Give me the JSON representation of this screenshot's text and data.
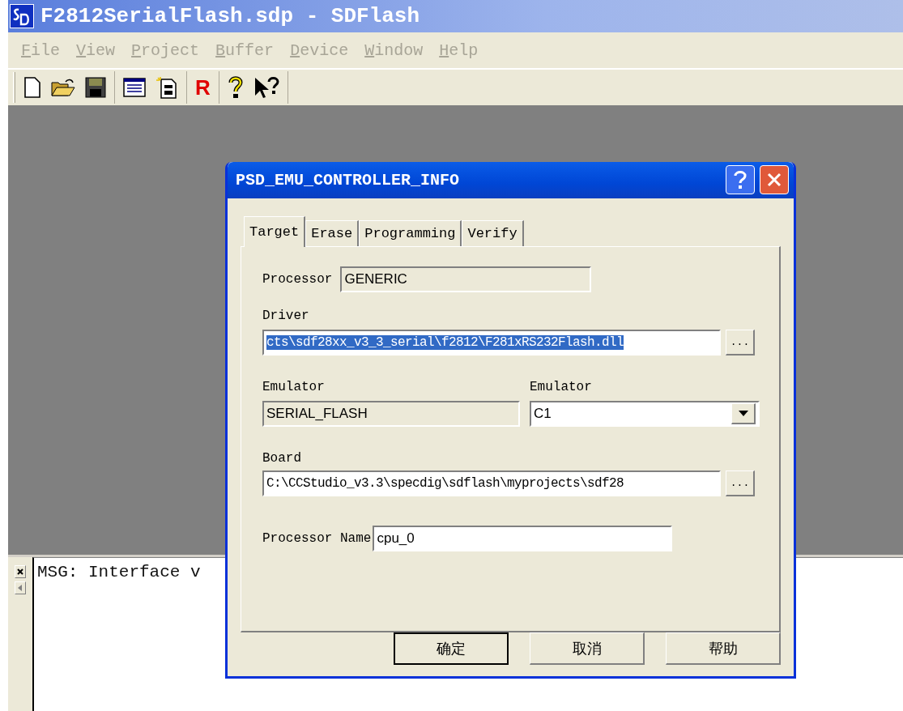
{
  "window": {
    "title": "F2812SerialFlash.sdp - SDFlash"
  },
  "menu": [
    {
      "label": "File",
      "disabled": true
    },
    {
      "label": "View",
      "disabled": true
    },
    {
      "label": "Project",
      "disabled": true
    },
    {
      "label": "Buffer",
      "disabled": true
    },
    {
      "label": "Device",
      "disabled": true
    },
    {
      "label": "Window",
      "disabled": true
    },
    {
      "label": "Help",
      "disabled": true
    }
  ],
  "toolbar": {
    "reset_label": "R"
  },
  "output": {
    "lines": [
      "MSG: Interface v"
    ]
  },
  "dialog": {
    "title": "PSD_EMU_CONTROLLER_INFO",
    "tabs": [
      {
        "label": "Target",
        "selected": true
      },
      {
        "label": "Erase",
        "selected": false
      },
      {
        "label": "Programming",
        "selected": false
      },
      {
        "label": "Verify",
        "selected": false
      }
    ],
    "processor": {
      "label": "Processor",
      "value": "GENERIC"
    },
    "driver": {
      "label": "Driver",
      "value": "cts\\sdf28xx_v3_3_serial\\f2812\\F281xRS232Flash.dll",
      "highlighted": true,
      "browse": "..."
    },
    "emulator": {
      "label": "Emulator",
      "value": "SERIAL_FLASH"
    },
    "emulator_select": {
      "label": "Emulator",
      "value": "C1"
    },
    "board": {
      "label": "Board",
      "value": "C:\\CCStudio_v3.3\\specdig\\sdflash\\myprojects\\sdf28",
      "highlighted": false,
      "browse": "..."
    },
    "processor_name": {
      "label": "Processor Name",
      "value": "cpu_0"
    },
    "buttons": [
      {
        "label": "确定",
        "default": true
      },
      {
        "label": "取消",
        "default": false
      },
      {
        "label": "帮助",
        "default": false
      }
    ]
  }
}
